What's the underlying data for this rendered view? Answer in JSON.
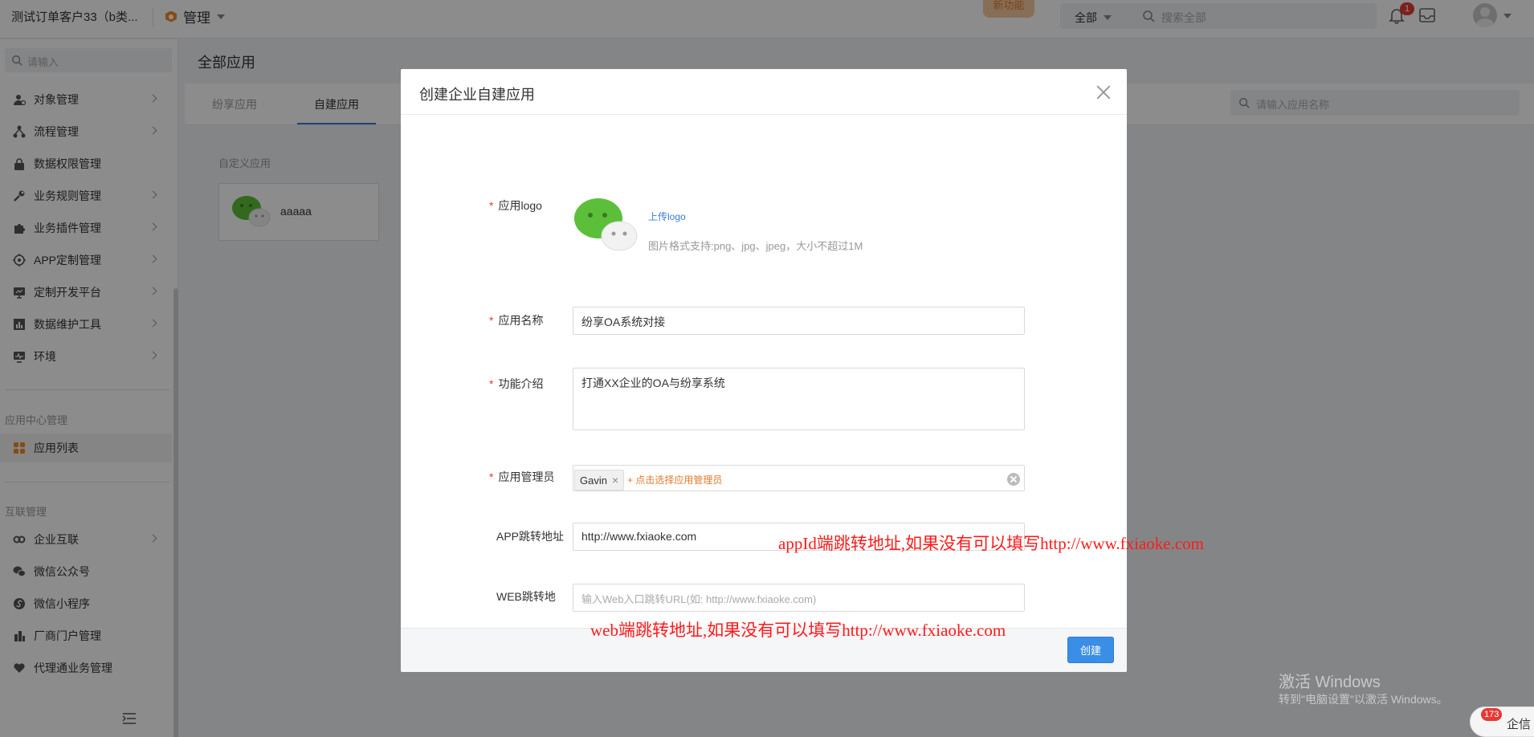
{
  "topbar": {
    "company": "测试订单客户33（b类...",
    "manage_label": "管理",
    "new_feature": "新功能",
    "search_scope": "全部",
    "search_placeholder": "搜索全部",
    "notification_count": "1",
    "icons": [
      "manage-hex-icon",
      "bell-icon",
      "inbox-icon",
      "avatar"
    ]
  },
  "sidebar": {
    "search_placeholder": "请输入",
    "items": [
      {
        "label": "对象管理",
        "icon": "object-icon",
        "arrow": true
      },
      {
        "label": "流程管理",
        "icon": "flow-icon",
        "arrow": true
      },
      {
        "label": "数据权限管理",
        "icon": "lock-icon",
        "arrow": false
      },
      {
        "label": "业务规则管理",
        "icon": "wrench-icon",
        "arrow": true
      },
      {
        "label": "业务插件管理",
        "icon": "puzzle-icon",
        "arrow": true
      },
      {
        "label": "APP定制管理",
        "icon": "app-gear-icon",
        "arrow": true
      },
      {
        "label": "定制开发平台",
        "icon": "monitor-icon",
        "arrow": true
      },
      {
        "label": "数据维护工具",
        "icon": "chart-icon",
        "arrow": true
      },
      {
        "label": "环境",
        "icon": "env-icon",
        "arrow": true
      }
    ],
    "section_app_center": "应用中心管理",
    "app_list": "应用列表",
    "section_interconnect": "互联管理",
    "interconnect_items": [
      {
        "label": "企业互联",
        "icon": "link-icon",
        "arrow": true
      },
      {
        "label": "微信公众号",
        "icon": "wechat-icon",
        "arrow": false
      },
      {
        "label": "微信小程序",
        "icon": "miniprogram-icon",
        "arrow": false
      },
      {
        "label": "厂商门户管理",
        "icon": "building-icon",
        "arrow": false
      },
      {
        "label": "代理通业务管理",
        "icon": "heart-icon",
        "arrow": false
      }
    ]
  },
  "main": {
    "title": "全部应用",
    "tabs": [
      {
        "label": "纷享应用"
      },
      {
        "label": "自建应用"
      }
    ],
    "app_search_placeholder": "请输入应用名称",
    "section_label": "自定义应用",
    "apps": [
      {
        "name": "aaaaa"
      }
    ]
  },
  "modal": {
    "title": "创建企业自建应用",
    "logo_label": "应用logo",
    "upload_label": "上传logo",
    "logo_hint": "图片格式支持:png、jpg、jpeg，大小不超过1M",
    "name_label": "应用名称",
    "name_value": "纷享OA系统对接",
    "desc_label": "功能介绍",
    "desc_value": "打通XX企业的OA与纷享系统",
    "admin_label": "应用管理员",
    "admin_tag": "Gavin",
    "admin_add": "+ 点击选择应用管理员",
    "app_url_label": "APP跳转地址",
    "app_url_value": "http://www.fxiaoke.com",
    "web_url_label": "WEB跳转地",
    "web_url_placeholder": "输入Web入口跳转URL(如: http://www.fxiaoke.com)",
    "create_button": "创建"
  },
  "annotations": {
    "app": "appId端跳转地址,如果没有可以填写http://www.fxiaoke.com",
    "web": "web端跳转地址,如果没有可以填写http://www.fxiaoke.com"
  },
  "watermark": {
    "title": "激活 Windows",
    "subtitle": "转到\"电脑设置\"以激活 Windows。"
  },
  "chat": {
    "count": "173",
    "label": "企信"
  },
  "colors": {
    "primary": "#3a8ee6",
    "accent_orange": "#e07a2c",
    "required": "#e53935",
    "annotation": "#ff1a1a",
    "wechat_green": "#5bbf3a"
  }
}
